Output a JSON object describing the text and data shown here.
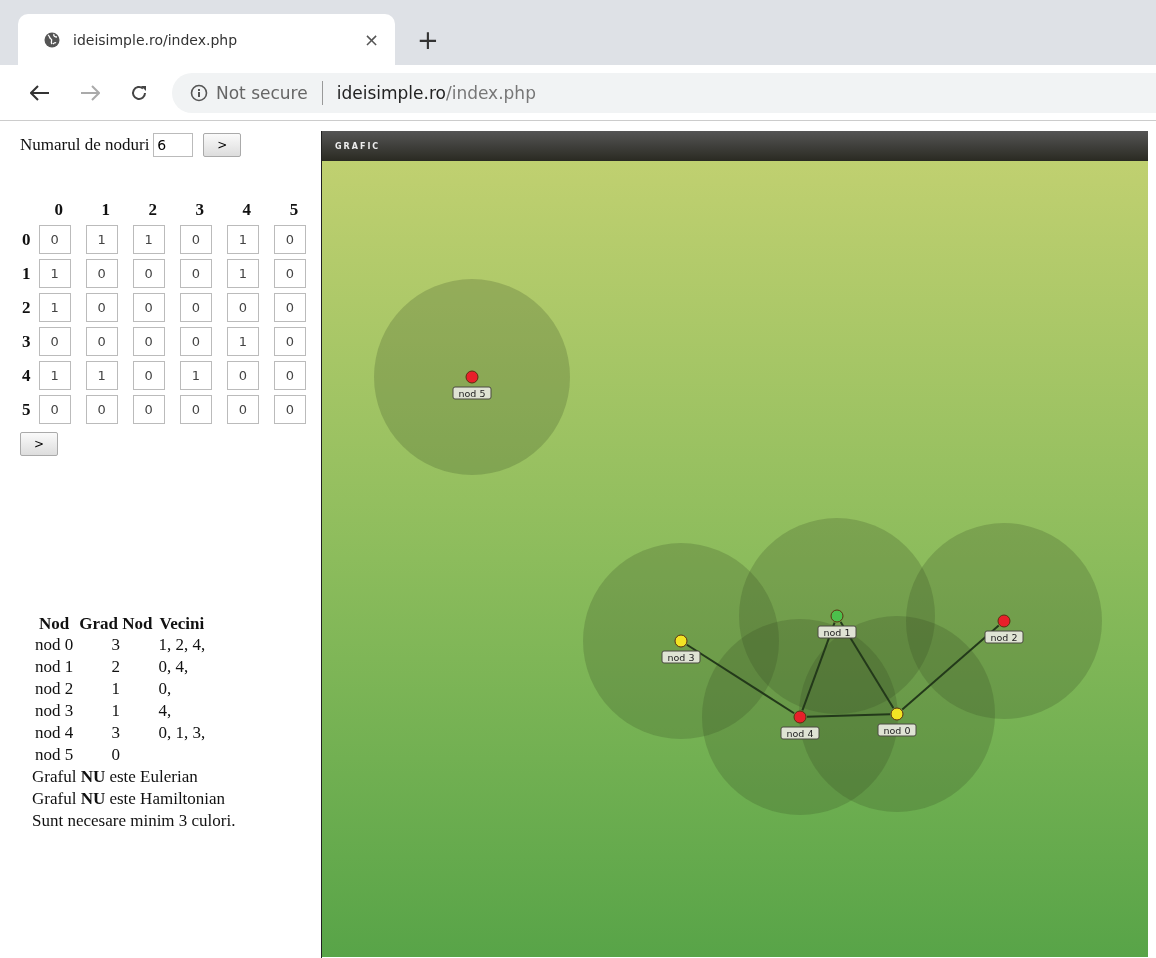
{
  "browser": {
    "tab": {
      "title": "ideisimple.ro/index.php",
      "close": "×",
      "selected": true
    },
    "new_tab": "+",
    "address": {
      "security": "Not secure",
      "host": "ideisimple.ro",
      "path": "/index.php"
    }
  },
  "form": {
    "label": "Numarul de noduri",
    "value": "6",
    "button": ">"
  },
  "matrix": {
    "columns": [
      "0",
      "1",
      "2",
      "3",
      "4",
      "5"
    ],
    "rows": [
      {
        "label": "0",
        "cells": [
          "0",
          "1",
          "1",
          "0",
          "1",
          "0"
        ]
      },
      {
        "label": "1",
        "cells": [
          "1",
          "0",
          "0",
          "0",
          "1",
          "0"
        ]
      },
      {
        "label": "2",
        "cells": [
          "1",
          "0",
          "0",
          "0",
          "0",
          "0"
        ]
      },
      {
        "label": "3",
        "cells": [
          "0",
          "0",
          "0",
          "0",
          "1",
          "0"
        ]
      },
      {
        "label": "4",
        "cells": [
          "1",
          "1",
          "0",
          "1",
          "0",
          "0"
        ]
      },
      {
        "label": "5",
        "cells": [
          "0",
          "0",
          "0",
          "0",
          "0",
          "0"
        ]
      }
    ],
    "button": ">"
  },
  "degrees": {
    "columns": [
      "Nod",
      "Grad Nod",
      "Vecini"
    ],
    "rows": [
      {
        "node": "nod 0",
        "degree": "3",
        "neighbors": "1, 2, 4,"
      },
      {
        "node": "nod 1",
        "degree": "2",
        "neighbors": "0, 4,"
      },
      {
        "node": "nod 2",
        "degree": "1",
        "neighbors": "0,"
      },
      {
        "node": "nod 3",
        "degree": "1",
        "neighbors": "4,"
      },
      {
        "node": "nod 4",
        "degree": "3",
        "neighbors": "0, 1, 3,"
      },
      {
        "node": "nod 5",
        "degree": "0"
      }
    ]
  },
  "results": [
    "Graful **NU** este Eulerian",
    "Graful **NU** este Hamiltonian",
    "Sunt necesare minim 3 culori."
  ],
  "graph": {
    "title": "GRAFIC",
    "nodes": [
      {
        "label": "nod 0",
        "color": "#f2e424"
      },
      {
        "label": "nod 1",
        "color": "#4cc04c"
      },
      {
        "label": "nod 2",
        "color": "#e8202a"
      },
      {
        "label": "nod 3",
        "color": "#f2e424"
      },
      {
        "label": "nod 4",
        "color": "#e8202a"
      },
      {
        "label": "nod 5",
        "color": "#e8202a"
      }
    ]
  }
}
